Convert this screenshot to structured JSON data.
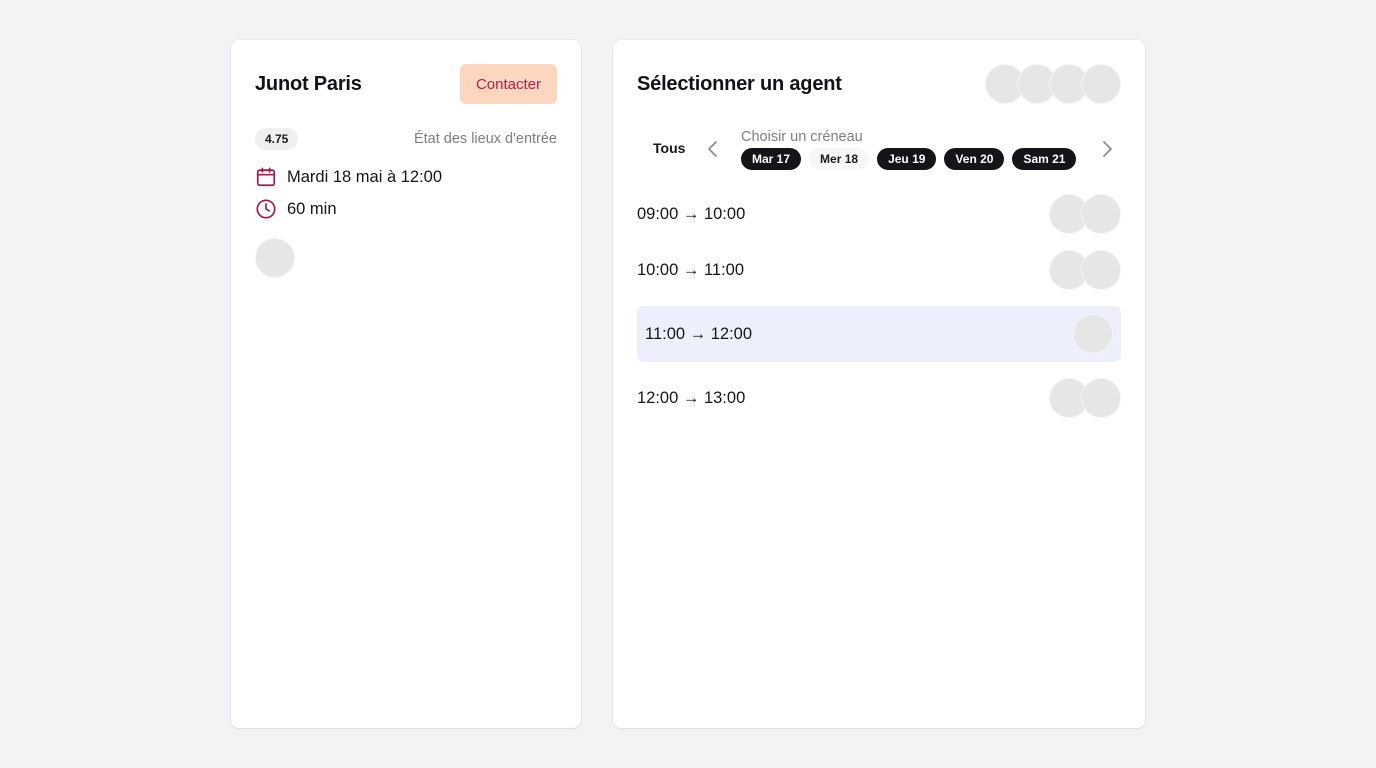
{
  "property": {
    "title": "Junot Paris",
    "contact_label": "Contacter",
    "rating": "4.75",
    "inspection_type": "État des lieux d'entrée",
    "date_text": "Mardi 18 mai à 12:00",
    "duration_text": "60 min"
  },
  "agent_panel": {
    "title": "Sélectionner un agent",
    "all_label": "Tous",
    "slot_caption": "Choisir un créneau",
    "days": [
      {
        "label": "Mar 17",
        "state": "active"
      },
      {
        "label": "Mer 18",
        "state": "inactive"
      },
      {
        "label": "Jeu 19",
        "state": "active"
      },
      {
        "label": "Ven 20",
        "state": "active"
      },
      {
        "label": "Sam 21",
        "state": "active"
      }
    ],
    "slots": [
      {
        "label": "09:00 → 10:00",
        "selected": false
      },
      {
        "label": "10:00 → 11:00",
        "selected": false
      },
      {
        "label": "11:00 → 12:00",
        "selected": true
      },
      {
        "label": "12:00 → 13:00",
        "selected": false
      }
    ]
  },
  "icons": {
    "calendar": "calendar-icon",
    "clock": "clock-icon",
    "prev": "chevron-left-icon",
    "next": "chevron-right-icon"
  },
  "colors": {
    "accent": "#a3174a",
    "contact_bg": "#fdd6bf",
    "contact_text": "#b0224a",
    "selected_slot_bg": "#eeeffc",
    "pill_active_bg": "#141518",
    "page_bg": "#f2f3f5"
  }
}
